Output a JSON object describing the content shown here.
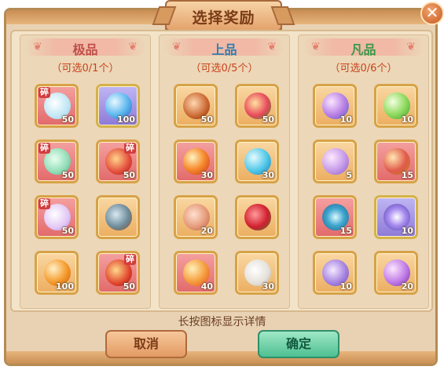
{
  "dialog": {
    "title": "选择奖励",
    "close_icon": "close-x-icon",
    "hint": "长按图标显示详情",
    "cancel_label": "取消",
    "confirm_label": "确定"
  },
  "columns": [
    {
      "title": "极品",
      "subtitle": "（可选0/1个）",
      "title_color": "#c0504a",
      "items": [
        {
          "icon": "unicorn-shard-icon",
          "count": "50",
          "fragment": "碎",
          "frame": "red"
        },
        {
          "icon": "blue-orb-icon",
          "count": "100",
          "frame": "purple"
        },
        {
          "icon": "dragon-pet-shard-icon",
          "count": "50",
          "fragment": "碎",
          "frame": "red"
        },
        {
          "icon": "red-treasure-box-shard-icon",
          "count": "50",
          "fragment": "碎",
          "frame": "red"
        },
        {
          "icon": "purple-pet-shard-icon",
          "count": "50",
          "fragment": "碎",
          "frame": "red"
        },
        {
          "icon": "treasure-chest-beast-icon",
          "count": "",
          "frame": "orange"
        },
        {
          "icon": "orange-orb-icon",
          "count": "100",
          "frame": "orange"
        },
        {
          "icon": "lucky-bag-shard-icon",
          "count": "50",
          "fragment": "碎",
          "frame": "red"
        }
      ]
    },
    {
      "title": "上品",
      "subtitle": "（可选0/5个）",
      "title_color": "#2f7fb0",
      "items": [
        {
          "icon": "gift-box-icon",
          "count": "50",
          "frame": "orange"
        },
        {
          "icon": "lucky-pouch-icon",
          "count": "50",
          "frame": "orange"
        },
        {
          "icon": "fire-orb-icon",
          "count": "30",
          "frame": "red"
        },
        {
          "icon": "water-orb-icon",
          "count": "30",
          "frame": "orange"
        },
        {
          "icon": "pink-chest-icon",
          "count": "20",
          "frame": "orange"
        },
        {
          "icon": "rose-bouquet-icon",
          "count": "",
          "frame": "orange"
        },
        {
          "icon": "peach-fruit-icon",
          "count": "40",
          "frame": "red"
        },
        {
          "icon": "scroll-paper-icon",
          "count": "30",
          "frame": "orange"
        }
      ]
    },
    {
      "title": "凡品",
      "subtitle": "（可选0/6个）",
      "title_color": "#3a9a4a",
      "items": [
        {
          "icon": "planet-orb-icon",
          "count": "10",
          "frame": "orange"
        },
        {
          "icon": "green-orb-icon",
          "count": "10",
          "frame": "orange"
        },
        {
          "icon": "purple-bubble-orb-icon",
          "count": "5",
          "frame": "orange"
        },
        {
          "icon": "red-crystal-orb-icon",
          "count": "15",
          "frame": "red"
        },
        {
          "icon": "lotus-disc-icon",
          "count": "15",
          "frame": "red"
        },
        {
          "icon": "purple-star-crystal-icon",
          "count": "10",
          "frame": "purple"
        },
        {
          "icon": "purple-crystal-cluster-icon",
          "count": "10",
          "frame": "orange"
        },
        {
          "icon": "violet-orb-icon",
          "count": "20",
          "frame": "orange"
        }
      ]
    }
  ]
}
